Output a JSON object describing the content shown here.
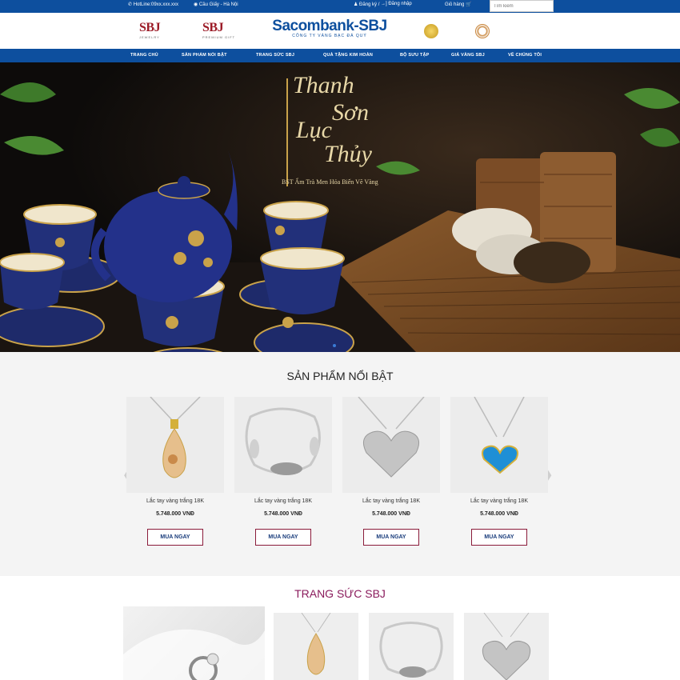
{
  "topbar": {
    "hotline": "HotLine:09xx.xxx.xxx",
    "address": "Cầu Giấy - Hà Nội",
    "register": "Đăng ký",
    "separator": "/",
    "login": "Đăng nhập",
    "cart": "Giỏ hàng",
    "search_placeholder": "Tìm kiếm"
  },
  "header": {
    "logo_left": "SBJ",
    "logo_left_sub": "JEWELRY",
    "logo_mid": "SBJ",
    "logo_mid_sub": "PREMIUM GIFT",
    "brand_title": "Sacombank-SBJ",
    "brand_sub": "CÔNG TY VÀNG BẠC ĐÁ QUÝ"
  },
  "nav": {
    "items": [
      "TRANG CHỦ",
      "SẢN PHẨM NỔI BẬT",
      "TRANG SỨC SBJ",
      "QUÀ TẶNG KIM HOÀN",
      "BỘ SƯU TẬP",
      "GIÁ VÀNG SBJ",
      "VỀ CHÚNG TÔI"
    ]
  },
  "hero": {
    "line1": "Thanh",
    "line2": "Sơn",
    "line3": "Lục",
    "line4": "Thủy",
    "subtitle": "BST Ấm Trà Men Hỏa Biến Vẽ Vàng"
  },
  "featured": {
    "title": "SẢN PHẨM NỔI BẬT",
    "products": [
      {
        "name": "Lắc tay vàng trắng 18K",
        "price": "5.748.000 VNĐ",
        "button": "MUA NGAY",
        "icon": "amber-drop-pendant"
      },
      {
        "name": "Lắc tay vàng trắng 18K",
        "price": "5.748.000 VNĐ",
        "button": "MUA NGAY",
        "icon": "silver-bracelet"
      },
      {
        "name": "Lắc tay vàng trắng 18K",
        "price": "5.748.000 VNĐ",
        "button": "MUA NGAY",
        "icon": "heart-pendant"
      },
      {
        "name": "Lắc tay vàng trắng 18K",
        "price": "5.748.000 VNĐ",
        "button": "MUA NGAY",
        "icon": "blue-heart-pendant"
      }
    ]
  },
  "jewelry": {
    "title": "TRANG SỨC SBJ"
  },
  "colors": {
    "primary": "#0d4f9e",
    "accent": "#8a1b3a",
    "section_bg": "#f4f4f4"
  }
}
